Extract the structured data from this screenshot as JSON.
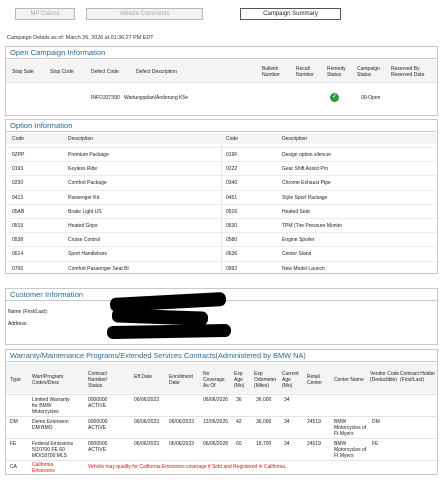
{
  "toolbar": {
    "mp_claims": "MP Claims",
    "vehicle_comments": "Vehicle Comments",
    "campaign_summary": "Campaign Summary"
  },
  "as_of": "Campaign Details as of: March 26, 2026 at 01:36:27 PM EDT",
  "open_campaign": {
    "title": "Open Campaign Information",
    "headers": {
      "stop_sale": "Stop Sale",
      "stop_code": "Stop Code",
      "defect_code": "Defect Code",
      "defect_description": "Defect Description",
      "bulletin_number": "Bulletin Number",
      "recall_number": "Recall Number",
      "remedy_status": "Remedy Status",
      "campaign_status": "Campaign Status",
      "reserved_by": "Reserved By Reserved Date"
    },
    "row": {
      "defect_code": "INFO337390",
      "defect_description": "Wartungsplan/Änderung K5e",
      "campaign_status": "00-Open"
    }
  },
  "option_info": {
    "title": "Option Information",
    "headers": {
      "code": "Code",
      "description": "Description"
    },
    "left": [
      {
        "code": "0ZPP",
        "desc": "Premium Package"
      },
      {
        "code": "0193",
        "desc": "Keyless Ride"
      },
      {
        "code": "0230",
        "desc": "Comfort Package"
      },
      {
        "code": "0413",
        "desc": "Passenger Kit"
      },
      {
        "code": "05AB",
        "desc": "Brake Light US"
      },
      {
        "code": "0519",
        "desc": "Heated Grips"
      },
      {
        "code": "0538",
        "desc": "Cruise Control"
      },
      {
        "code": "0614",
        "desc": "Sport Handlebars"
      },
      {
        "code": "0766",
        "desc": "Comfort Passenger Seat Bl"
      }
    ],
    "right": [
      {
        "code": "019F",
        "desc": "Design option silencer"
      },
      {
        "code": "0222",
        "desc": "Gear Shift Assist Pro"
      },
      {
        "code": "0340",
        "desc": "Chrome Exhaust Pipe"
      },
      {
        "code": "0451",
        "desc": "Style Sport Package"
      },
      {
        "code": "0516",
        "desc": "Heated Seat"
      },
      {
        "code": "0530",
        "desc": "TPM (Tire Pressure Monito"
      },
      {
        "code": "0580",
        "desc": "Engine Spoiler"
      },
      {
        "code": "0636",
        "desc": "Center Stand"
      },
      {
        "code": "0992",
        "desc": "New Model Launch"
      }
    ]
  },
  "customer": {
    "title": "Customer Information",
    "name_label": "Name (First/Last):",
    "address_label": "Address:"
  },
  "warranty": {
    "title": "Warranty/Maintenance Programs/Extended Services Contracts(Administered by BMW NA)",
    "headers": {
      "type": "Type",
      "program": "Warr/Program Codes/Desc",
      "contract": "Contract Number/ Status",
      "eff_date": "Eff Date",
      "enroll_date": "Enrollment Date",
      "no_coverage": "No Coverage As Of",
      "exp_age": "Exp Age (Mo)",
      "exp_odo": "Exp Odometer (Miles)",
      "current_age": "Current Age (Mo)",
      "retail_center": "Retail Center",
      "center_name": "Center Name",
      "vendor_code": "Vendor Code (Deductible)",
      "contract_holder": "Contract Holder (First/Last)"
    },
    "rows": [
      {
        "type": "",
        "program": "Limited Warranty for BMW Motorcycles",
        "contract": "0000000 ACTIVE",
        "eff": "06/06/2023",
        "enroll": "",
        "nocov": "06/06/2026",
        "expage": "36",
        "expodo": "36,000",
        "curage": "34",
        "retail": "",
        "center": "",
        "vendor": "",
        "holder": ""
      },
      {
        "type": "DM",
        "program": "Demo Extension DM BMO",
        "contract": "0000000 ACTIVE",
        "eff": "06/06/2023",
        "enroll": "06/06/2023",
        "nocov": "12/06/2026",
        "expage": "42",
        "expodo": "36,000",
        "curage": "34",
        "retail": "24519",
        "center": "BMW Motorcycles of Ft Myers",
        "vendor": "DM",
        "holder": ""
      },
      {
        "type": "FE",
        "program": "Federal Emissions 5/10700 FE 60 MO/18700 MLS",
        "contract": "0000000 ACTIVE",
        "eff": "06/06/2023",
        "enroll": "06/06/2023",
        "nocov": "06/06/2028",
        "expage": "60",
        "expodo": "18,700",
        "curage": "34",
        "retail": "24519",
        "center": "BMW Motorcycles of Ft Myers",
        "vendor": "FE",
        "holder": ""
      }
    ],
    "ca_row": {
      "type": "CA",
      "program": "California Emissions",
      "note": "Vehicle may qualify for California Emissions coverage if Sold and Registered in California."
    }
  }
}
